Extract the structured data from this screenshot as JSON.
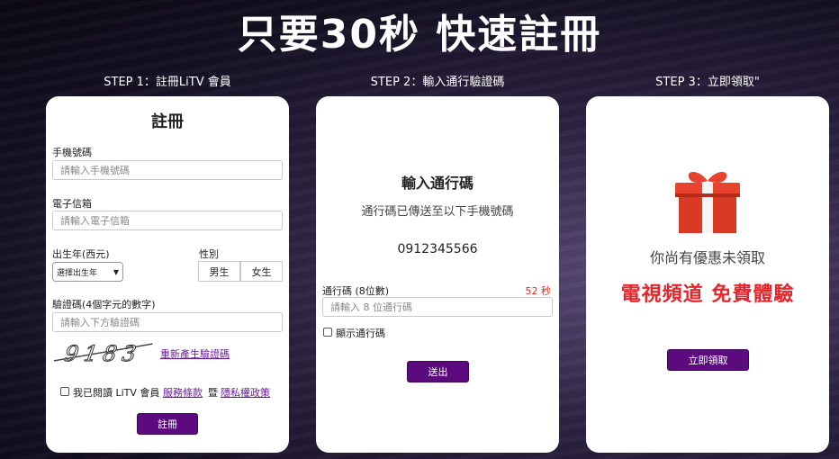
{
  "headline": "只要30秒  快速註冊",
  "steps": [
    {
      "label": "STEP 1：註冊LiTV 會員"
    },
    {
      "label": "STEP 2：輸入通行驗證碼"
    },
    {
      "label": "STEP 3：立即領取\""
    }
  ],
  "register": {
    "title": "註冊",
    "phone_label": "手機號碼",
    "phone_placeholder": "請輸入手機號碼",
    "email_label": "電子信箱",
    "email_placeholder": "請輸入電子信箱",
    "birth_label": "出生年(西元)",
    "birth_select": "選擇出生年",
    "gender_label": "性別",
    "gender_male": "男生",
    "gender_female": "女生",
    "captcha_label": "驗證碼(4個字元的數字)",
    "captcha_placeholder": "請輸入下方驗證碼",
    "captcha_value": "9183",
    "captcha_refresh": "重新產生驗證碼",
    "agree_text": "我已閱讀 LiTV 會員",
    "terms_link": "服務條款",
    "agree_and": "暨",
    "privacy_link": "隱私權政策",
    "submit": "註冊"
  },
  "verify": {
    "title": "輸入通行碼",
    "subtitle": "通行碼已傳送至以下手機號碼",
    "phone": "0912345566",
    "code_label": "通行碼 (8位數)",
    "countdown": "52 秒",
    "code_placeholder": "請輸入 8 位通行碼",
    "show_code": "顯示通行碼",
    "submit": "送出"
  },
  "claim": {
    "line1": "你尚有優惠未領取",
    "line2": "電視頻道 免費體驗",
    "button": "立即領取"
  },
  "colors": {
    "accent_purple": "#5b0b7e",
    "promo_red": "#e4262c",
    "countdown_red": "#d8301f",
    "gift_red": "#e8432e"
  },
  "icons": {
    "gift": "gift-icon",
    "select_arrow": "chevron-down-icon"
  }
}
